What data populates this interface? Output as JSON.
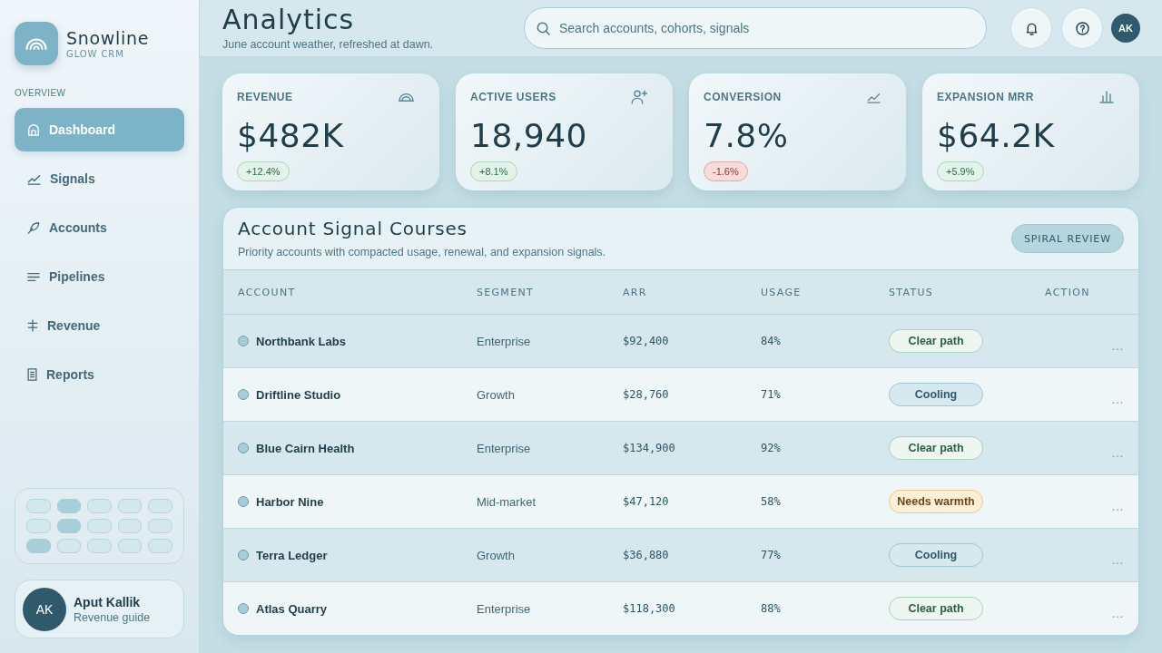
{
  "sidebar": {
    "brand": {
      "name": "Snowline",
      "tagline": "GLOW CRM"
    },
    "section_label": "OVERVIEW",
    "nav": [
      {
        "label": "Dashboard",
        "selected": true
      },
      {
        "label": "Signals",
        "selected": false
      },
      {
        "label": "Accounts",
        "selected": false
      },
      {
        "label": "Pipelines",
        "selected": false
      },
      {
        "label": "Revenue",
        "selected": false
      },
      {
        "label": "Reports",
        "selected": false
      }
    ],
    "tile_grid": {
      "rows": [
        {
          "tiles": [
            {
              "on": false
            },
            {
              "on": true
            },
            {
              "on": false
            },
            {
              "on": false
            },
            {
              "on": false
            }
          ]
        },
        {
          "tiles": [
            {
              "on": false
            },
            {
              "on": true
            },
            {
              "on": false
            },
            {
              "on": false
            },
            {
              "on": false
            }
          ]
        },
        {
          "tiles": [
            {
              "on": true
            },
            {
              "on": false
            },
            {
              "on": false
            },
            {
              "on": false
            },
            {
              "on": false
            }
          ]
        }
      ]
    },
    "user": {
      "initials": "AK",
      "name": "Aput Kallik",
      "role": "Revenue guide"
    }
  },
  "header": {
    "title": "Analytics",
    "subtitle": "June account weather, refreshed at dawn.",
    "search": {
      "placeholder": "Search accounts, cohorts, signals"
    },
    "avatar": {
      "initials": "AK"
    }
  },
  "kpis": [
    {
      "label": "REVENUE",
      "value": "$482K",
      "delta": {
        "text": "+12.4%",
        "negative": false
      }
    },
    {
      "label": "ACTIVE USERS",
      "value": "18,940",
      "delta": {
        "text": "+8.1%",
        "negative": false
      }
    },
    {
      "label": "CONVERSION",
      "value": "7.8%",
      "delta": {
        "text": "-1.6%",
        "negative": true
      }
    },
    {
      "label": "EXPANSION MRR",
      "value": "$64.2K",
      "delta": {
        "text": "+5.9%",
        "negative": false
      }
    }
  ],
  "table": {
    "title": "Account Signal Courses",
    "subtitle": "Priority accounts with compacted usage, renewal, and expansion signals.",
    "button": "SPIRAL REVIEW",
    "columns": [
      "ACCOUNT",
      "SEGMENT",
      "ARR",
      "USAGE",
      "STATUS",
      "ACTION"
    ],
    "rows": [
      {
        "account": "Northbank Labs",
        "segment": "Enterprise",
        "arr": "$92,400",
        "usage": "84%",
        "status": {
          "label": "Clear path",
          "kind": "good"
        },
        "action": "…"
      },
      {
        "account": "Driftline Studio",
        "segment": "Growth",
        "arr": "$28,760",
        "usage": "71%",
        "status": {
          "label": "Cooling",
          "kind": "cool"
        },
        "action": "…"
      },
      {
        "account": "Blue Cairn Health",
        "segment": "Enterprise",
        "arr": "$134,900",
        "usage": "92%",
        "status": {
          "label": "Clear path",
          "kind": "good"
        },
        "action": "…"
      },
      {
        "account": "Harbor Nine",
        "segment": "Mid-market",
        "arr": "$47,120",
        "usage": "58%",
        "status": {
          "label": "Needs warmth",
          "kind": "warm"
        },
        "action": "…"
      },
      {
        "account": "Terra Ledger",
        "segment": "Growth",
        "arr": "$36,880",
        "usage": "77%",
        "status": {
          "label": "Cooling",
          "kind": "cool"
        },
        "action": "…"
      },
      {
        "account": "Atlas Quarry",
        "segment": "Enterprise",
        "arr": "$118,300",
        "usage": "88%",
        "status": {
          "label": "Clear path",
          "kind": "good"
        },
        "action": "…"
      }
    ]
  }
}
